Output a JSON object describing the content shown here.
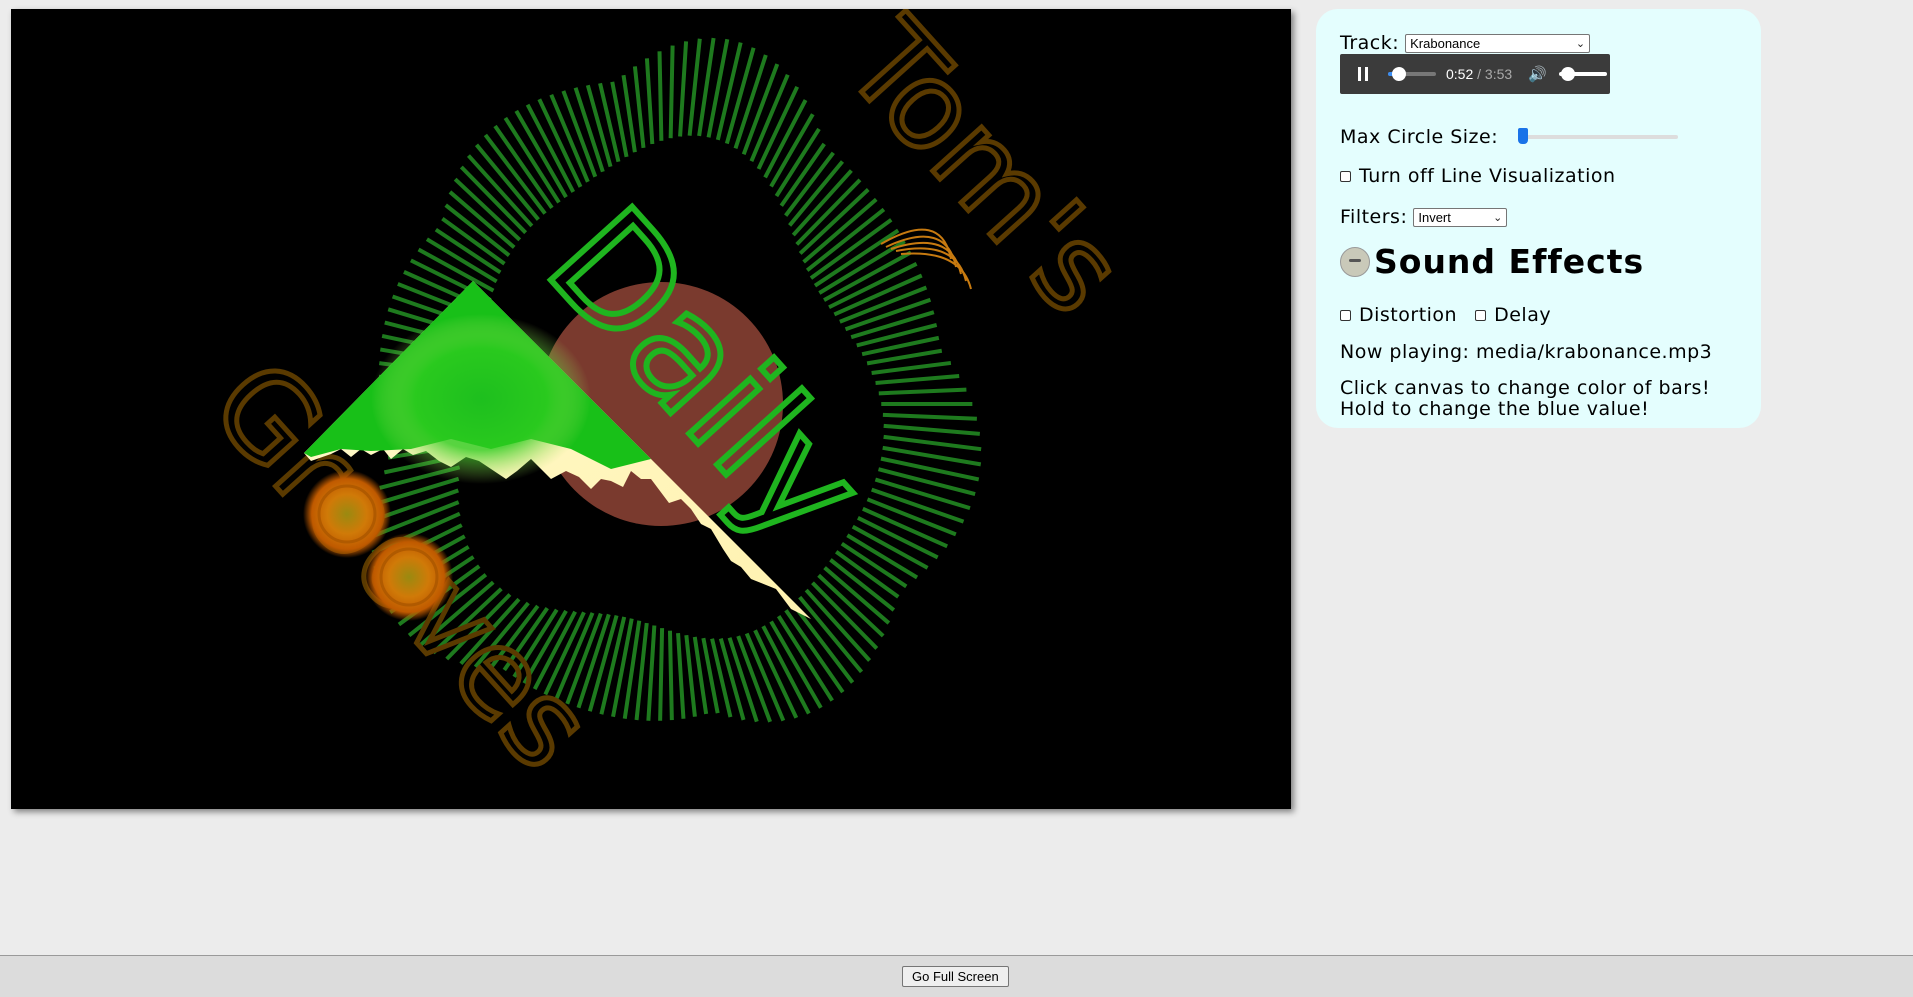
{
  "canvas": {
    "logo_words": [
      "Tom's",
      "Daily",
      "Grooves"
    ]
  },
  "controls": {
    "track_label": "Track:",
    "track_selected": "Krabonance",
    "player": {
      "current_time": "0:52",
      "time_separator": " / ",
      "duration": "3:53",
      "progress_fraction": 0.22,
      "volume_fraction": 0.2
    },
    "max_circle_label": "Max Circle Size:",
    "max_circle_fraction": 0.03,
    "line_viz_label": "Turn off Line Visualization",
    "filters_label": "Filters:",
    "filters_selected": "Invert",
    "sound_effects_title": "Sound Effects",
    "distortion_label": "Distortion",
    "delay_label": "Delay",
    "now_playing": "Now playing: media/krabonance.mp3",
    "hint_line1": "Click canvas to change color of bars!",
    "hint_line2": "Hold to change the blue value!"
  },
  "footer": {
    "fullscreen_label": "Go Full Screen"
  },
  "colors": {
    "panel_bg": "#e4fefe",
    "bars": "#1e7a1e",
    "logo_orange": "#5a3a00",
    "logo_green": "#1fb51f",
    "circle": "#7a3a2e",
    "wave_cream": "#fff8c0",
    "wave_green": "#22cc22",
    "orb_orange": "#e08a0a"
  }
}
